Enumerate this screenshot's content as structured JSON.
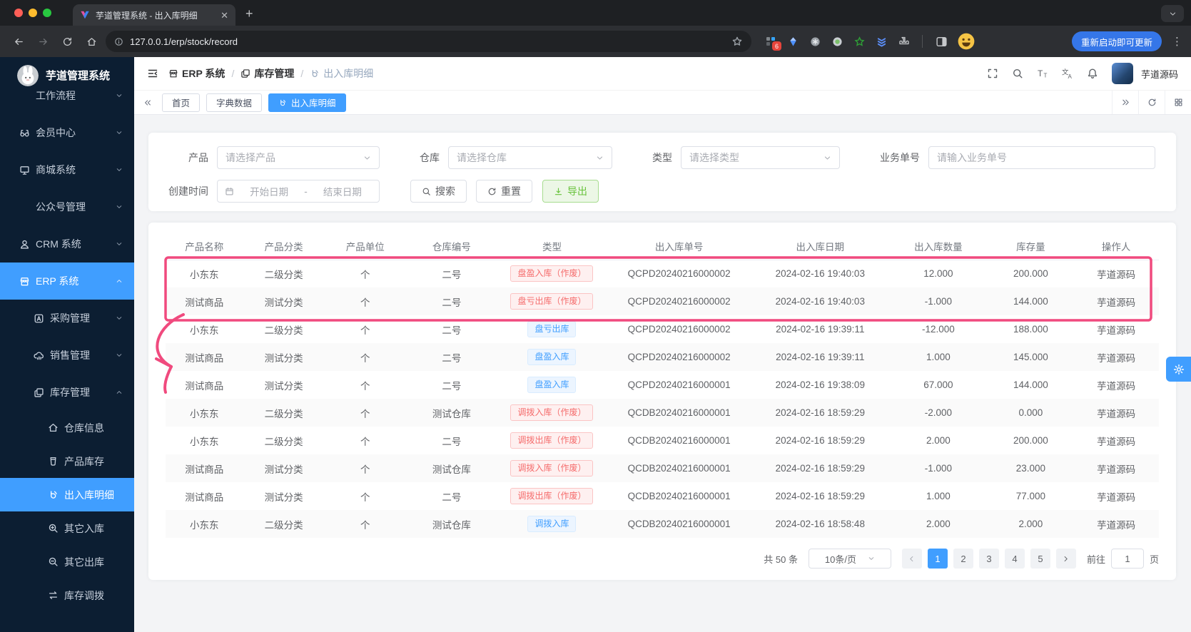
{
  "colors": {
    "primary": "#409eff",
    "success": "#67c23a",
    "danger": "#f56c6c",
    "annotation_pink": "#f04a7e",
    "sidebar_bg": "#0c1e32"
  },
  "browser": {
    "tab_title": "芋道管理系统 - 出入库明细",
    "url": "127.0.0.1/erp/stock/record",
    "extension_badge": "6",
    "update_button": "重新启动即可更新"
  },
  "sidebar": {
    "logo_title": "芋道管理系统",
    "menu": [
      {
        "id": "workflow",
        "label": "工作流程",
        "icon": "",
        "level": 1,
        "chevron": "down",
        "active": false
      },
      {
        "id": "member",
        "label": "会员中心",
        "icon": "member",
        "level": 1,
        "chevron": "down",
        "active": false
      },
      {
        "id": "mall",
        "label": "商城系统",
        "icon": "mall",
        "level": 1,
        "chevron": "down",
        "active": false
      },
      {
        "id": "mp",
        "label": "公众号管理",
        "icon": "",
        "level": 1,
        "chevron": "down",
        "active": false
      },
      {
        "id": "crm",
        "label": "CRM 系统",
        "icon": "crm",
        "level": 1,
        "chevron": "down",
        "active": false
      },
      {
        "id": "erp",
        "label": "ERP 系统",
        "icon": "storefront",
        "level": 1,
        "chevron": "up",
        "active": true
      },
      {
        "id": "purchase",
        "label": "采购管理",
        "icon": "purchase",
        "level": 2,
        "chevron": "down",
        "active": false
      },
      {
        "id": "sales",
        "label": "销售管理",
        "icon": "sales",
        "level": 2,
        "chevron": "down",
        "active": false
      },
      {
        "id": "stock",
        "label": "库存管理",
        "icon": "stock",
        "level": 2,
        "chevron": "up",
        "active": false
      },
      {
        "id": "warehouse-info",
        "label": "仓库信息",
        "icon": "warehouse",
        "level": 3,
        "chevron": "",
        "active": false
      },
      {
        "id": "product-stock",
        "label": "产品库存",
        "icon": "product",
        "level": 3,
        "chevron": "",
        "active": false
      },
      {
        "id": "stock-record",
        "label": "出入库明细",
        "icon": "record",
        "level": 3,
        "chevron": "",
        "active": true
      },
      {
        "id": "other-in",
        "label": "其它入库",
        "icon": "zoom-in",
        "level": 3,
        "chevron": "",
        "active": false
      },
      {
        "id": "other-out",
        "label": "其它出库",
        "icon": "zoom-out",
        "level": 3,
        "chevron": "",
        "active": false
      },
      {
        "id": "stock-move",
        "label": "库存调拨",
        "icon": "transfer",
        "level": 3,
        "chevron": "",
        "active": false
      }
    ]
  },
  "header": {
    "breadcrumb": [
      {
        "icon": "storefront",
        "label": "ERP 系统",
        "muted": false
      },
      {
        "icon": "stock",
        "label": "库存管理",
        "muted": false
      },
      {
        "icon": "record",
        "label": "出入库明细",
        "muted": true
      }
    ],
    "username": "芋道源码"
  },
  "tags": {
    "tabs": [
      {
        "label": "首页",
        "active": false,
        "icon": ""
      },
      {
        "label": "字典数据",
        "active": false,
        "icon": ""
      },
      {
        "label": "出入库明细",
        "active": true,
        "icon": "record"
      }
    ]
  },
  "filters": {
    "product_label": "产品",
    "product_placeholder": "请选择产品",
    "warehouse_label": "仓库",
    "warehouse_placeholder": "请选择仓库",
    "type_label": "类型",
    "type_placeholder": "请选择类型",
    "bizno_label": "业务单号",
    "bizno_placeholder": "请输入业务单号",
    "date_label": "创建时间",
    "date_start_placeholder": "开始日期",
    "date_separator": "-",
    "date_end_placeholder": "结束日期",
    "search_button": "搜索",
    "reset_button": "重置",
    "export_button": "导出"
  },
  "table": {
    "columns": [
      "产品名称",
      "产品分类",
      "产品单位",
      "仓库编号",
      "类型",
      "出入库单号",
      "出入库日期",
      "出入库数量",
      "库存量",
      "操作人"
    ],
    "rows": [
      {
        "name": "小东东",
        "category": "二级分类",
        "unit": "个",
        "warehouse": "二号",
        "type": "盘盈入库（作废）",
        "type_variant": "danger",
        "order_no": "QCPD20240216000002",
        "date": "2024-02-16 19:40:03",
        "quantity": "12.000",
        "stock": "200.000",
        "operator": "芋道源码"
      },
      {
        "name": "测试商品",
        "category": "测试分类",
        "unit": "个",
        "warehouse": "二号",
        "type": "盘亏出库（作废）",
        "type_variant": "danger",
        "order_no": "QCPD20240216000002",
        "date": "2024-02-16 19:40:03",
        "quantity": "-1.000",
        "stock": "144.000",
        "operator": "芋道源码"
      },
      {
        "name": "小东东",
        "category": "二级分类",
        "unit": "个",
        "warehouse": "二号",
        "type": "盘亏出库",
        "type_variant": "primary",
        "order_no": "QCPD20240216000002",
        "date": "2024-02-16 19:39:11",
        "quantity": "-12.000",
        "stock": "188.000",
        "operator": "芋道源码"
      },
      {
        "name": "测试商品",
        "category": "测试分类",
        "unit": "个",
        "warehouse": "二号",
        "type": "盘盈入库",
        "type_variant": "primary",
        "order_no": "QCPD20240216000002",
        "date": "2024-02-16 19:39:11",
        "quantity": "1.000",
        "stock": "145.000",
        "operator": "芋道源码"
      },
      {
        "name": "测试商品",
        "category": "测试分类",
        "unit": "个",
        "warehouse": "二号",
        "type": "盘盈入库",
        "type_variant": "primary",
        "order_no": "QCPD20240216000001",
        "date": "2024-02-16 19:38:09",
        "quantity": "67.000",
        "stock": "144.000",
        "operator": "芋道源码"
      },
      {
        "name": "小东东",
        "category": "二级分类",
        "unit": "个",
        "warehouse": "测试仓库",
        "type": "调拨入库（作废）",
        "type_variant": "danger",
        "order_no": "QCDB20240216000001",
        "date": "2024-02-16 18:59:29",
        "quantity": "-2.000",
        "stock": "0.000",
        "operator": "芋道源码"
      },
      {
        "name": "小东东",
        "category": "二级分类",
        "unit": "个",
        "warehouse": "二号",
        "type": "调拨出库（作废）",
        "type_variant": "danger",
        "order_no": "QCDB20240216000001",
        "date": "2024-02-16 18:59:29",
        "quantity": "2.000",
        "stock": "200.000",
        "operator": "芋道源码"
      },
      {
        "name": "测试商品",
        "category": "测试分类",
        "unit": "个",
        "warehouse": "测试仓库",
        "type": "调拨入库（作废）",
        "type_variant": "danger",
        "order_no": "QCDB20240216000001",
        "date": "2024-02-16 18:59:29",
        "quantity": "-1.000",
        "stock": "23.000",
        "operator": "芋道源码"
      },
      {
        "name": "测试商品",
        "category": "测试分类",
        "unit": "个",
        "warehouse": "二号",
        "type": "调拨出库（作废）",
        "type_variant": "danger",
        "order_no": "QCDB20240216000001",
        "date": "2024-02-16 18:59:29",
        "quantity": "1.000",
        "stock": "77.000",
        "operator": "芋道源码"
      },
      {
        "name": "小东东",
        "category": "二级分类",
        "unit": "个",
        "warehouse": "测试仓库",
        "type": "调拨入库",
        "type_variant": "primary",
        "order_no": "QCDB20240216000001",
        "date": "2024-02-16 18:58:48",
        "quantity": "2.000",
        "stock": "2.000",
        "operator": "芋道源码"
      }
    ]
  },
  "pagination": {
    "total": "共 50 条",
    "page_size": "10条/页",
    "pages": [
      "1",
      "2",
      "3",
      "4",
      "5"
    ],
    "active_page": "1",
    "goto_label": "前往",
    "goto_value": "1",
    "goto_unit": "页"
  }
}
